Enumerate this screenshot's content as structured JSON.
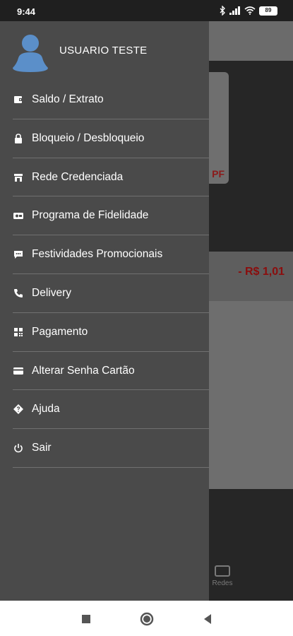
{
  "status_bar": {
    "time": "9:44",
    "battery": "89"
  },
  "background": {
    "card_text": "PF",
    "amount": "- R$ 1,01",
    "tab_label": "Redes"
  },
  "drawer": {
    "user_name": "USUARIO TESTE",
    "items": [
      {
        "label": "Saldo / Extrato",
        "icon": "wallet-icon"
      },
      {
        "label": "Bloqueio / Desbloqueio",
        "icon": "lock-icon"
      },
      {
        "label": "Rede Credenciada",
        "icon": "store-icon"
      },
      {
        "label": "Programa de Fidelidade",
        "icon": "loyalty-icon"
      },
      {
        "label": "Festividades Promocionais",
        "icon": "chat-bubble-icon"
      },
      {
        "label": "Delivery",
        "icon": "phone-icon"
      },
      {
        "label": "Pagamento",
        "icon": "qr-code-icon"
      },
      {
        "label": "Alterar Senha Cartão",
        "icon": "card-icon"
      },
      {
        "label": "Ajuda",
        "icon": "help-diamond-icon"
      },
      {
        "label": "Sair",
        "icon": "power-icon"
      }
    ]
  }
}
